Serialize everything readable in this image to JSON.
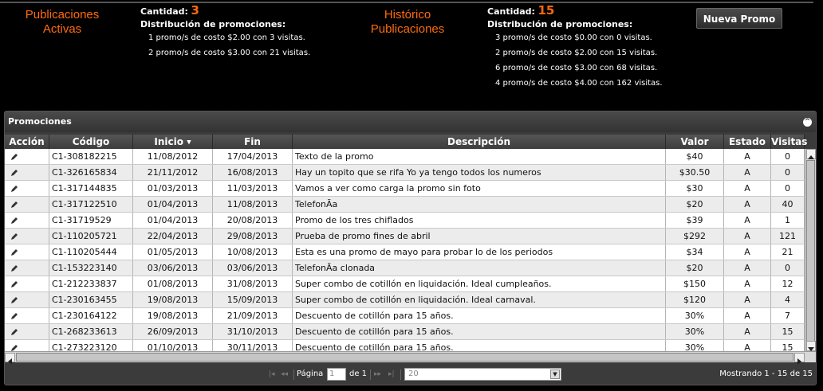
{
  "activas": {
    "title_line1": "Publicaciones",
    "title_line2": "Activas",
    "cantidad_label": "Cantidad:",
    "cantidad": "3",
    "dist_label": "Distribución de promociones:",
    "lines": [
      "1 promo/s de costo $2.00 con 3 visitas.",
      "2 promo/s de costo $3.00 con 21 visitas."
    ]
  },
  "historico": {
    "title_line1": "Histórico",
    "title_line2": "Publicaciones",
    "cantidad_label": "Cantidad:",
    "cantidad": "15",
    "dist_label": "Distribución de promociones:",
    "lines": [
      "3 promo/s de costo $0.00 con 0 visitas.",
      "2 promo/s de costo $2.00 con 15 visitas.",
      "6 promo/s de costo $3.00 con 68 visitas.",
      "4 promo/s de costo $4.00 con 162 visitas."
    ]
  },
  "nueva_promo_label": "Nueva Promo",
  "panel": {
    "title": "Promociones",
    "collapse_icon": "circle-chevron-up-icon"
  },
  "columns": [
    "Acción",
    "Código",
    "Inicio",
    "Fin",
    "Descripción",
    "Valor",
    "Estado",
    "Visitas"
  ],
  "sort_indicator": "▼",
  "rows": [
    {
      "codigo": "C1-308182215",
      "inicio": "11/08/2012",
      "fin": "17/04/2013",
      "descripcion": "Texto de la promo",
      "valor": "$40",
      "estado": "A",
      "visitas": "0"
    },
    {
      "codigo": "C1-326165834",
      "inicio": "21/11/2012",
      "fin": "16/08/2013",
      "descripcion": "Hay un topito que se rifa Yo ya tengo todos los numeros",
      "valor": "$30.50",
      "estado": "A",
      "visitas": "0"
    },
    {
      "codigo": "C1-317144835",
      "inicio": "01/03/2013",
      "fin": "11/03/2013",
      "descripcion": "Vamos a ver como carga la promo sin foto",
      "valor": "$30",
      "estado": "A",
      "visitas": "0"
    },
    {
      "codigo": "C1-317122510",
      "inicio": "01/04/2013",
      "fin": "11/08/2013",
      "descripcion": "TelefonÃa",
      "valor": "$20",
      "estado": "A",
      "visitas": "40"
    },
    {
      "codigo": "C1-31719529",
      "inicio": "01/04/2013",
      "fin": "20/08/2013",
      "descripcion": "Promo de los tres chiflados",
      "valor": "$39",
      "estado": "A",
      "visitas": "1"
    },
    {
      "codigo": "C1-110205721",
      "inicio": "22/04/2013",
      "fin": "29/08/2013",
      "descripcion": "Prueba de promo fines de abril",
      "valor": "$292",
      "estado": "A",
      "visitas": "121"
    },
    {
      "codigo": "C1-110205444",
      "inicio": "01/05/2013",
      "fin": "10/08/2013",
      "descripcion": "Esta es una promo de mayo para probar lo de los periodos",
      "valor": "$34",
      "estado": "A",
      "visitas": "21"
    },
    {
      "codigo": "C1-153223140",
      "inicio": "03/06/2013",
      "fin": "03/06/2013",
      "descripcion": "TelefonÃa clonada",
      "valor": "$20",
      "estado": "A",
      "visitas": "0"
    },
    {
      "codigo": "C1-212233837",
      "inicio": "01/08/2013",
      "fin": "31/08/2013",
      "descripcion": "Super combo de cotillón en liquidación. Ideal cumpleaños.",
      "valor": "$150",
      "estado": "A",
      "visitas": "12"
    },
    {
      "codigo": "C1-230163455",
      "inicio": "19/08/2013",
      "fin": "15/09/2013",
      "descripcion": "Super combo de cotillón en liquidación. Ideal carnaval.",
      "valor": "$120",
      "estado": "A",
      "visitas": "4"
    },
    {
      "codigo": "C1-230164122",
      "inicio": "19/08/2013",
      "fin": "21/09/2013",
      "descripcion": "Descuento de cotillón para 15 años.",
      "valor": "30%",
      "estado": "A",
      "visitas": "7"
    },
    {
      "codigo": "C1-268233613",
      "inicio": "26/09/2013",
      "fin": "31/10/2013",
      "descripcion": "Descuento de cotillón para 15 años.",
      "valor": "30%",
      "estado": "A",
      "visitas": "15"
    },
    {
      "codigo": "C1-273223120",
      "inicio": "01/10/2013",
      "fin": "30/11/2013",
      "descripcion": "Descuento de cotillón para 15 años.",
      "valor": "30%",
      "estado": "A",
      "visitas": "15"
    }
  ],
  "pager": {
    "first_icon": "first-page-icon",
    "prev_icon": "prev-page-icon",
    "next_icon": "next-page-icon",
    "last_icon": "last-page-icon",
    "page_label": "Página",
    "page_value": "1",
    "of_label": "de 1",
    "page_size": "20",
    "count_text": "Mostrando 1 - 15 de 15"
  }
}
